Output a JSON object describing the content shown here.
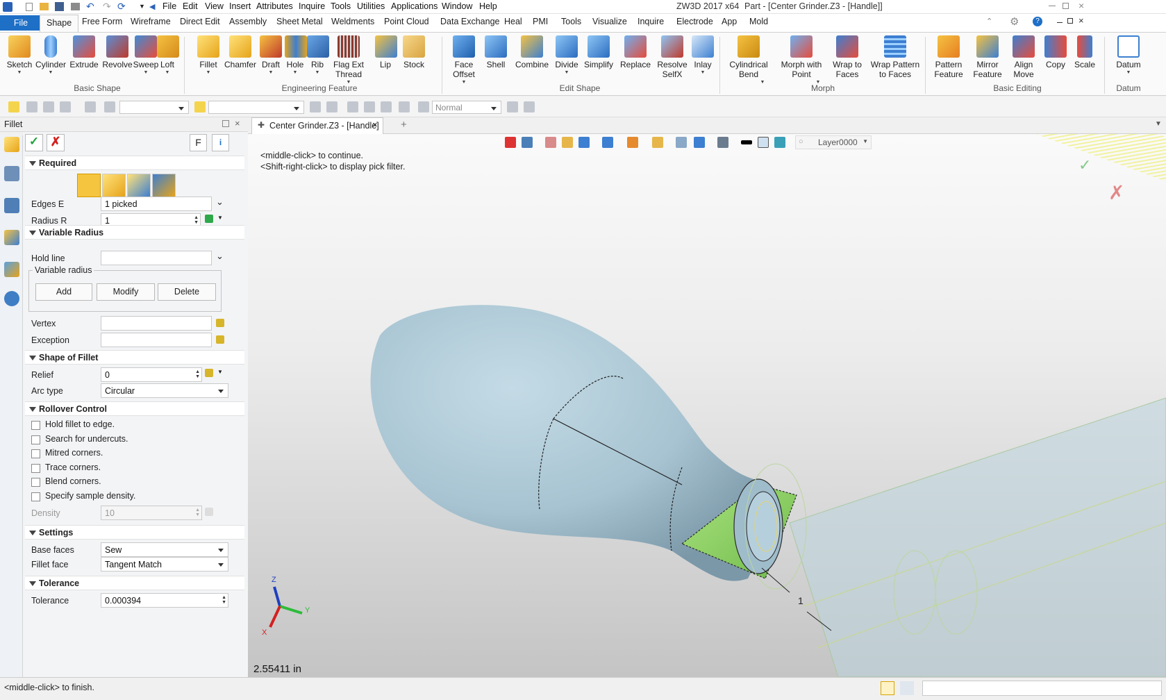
{
  "title_bar": {
    "menu": [
      "File",
      "Edit",
      "View",
      "Insert",
      "Attributes",
      "Inquire",
      "Tools",
      "Utilities",
      "Applications",
      "Window",
      "Help"
    ],
    "app_title": "ZW3D 2017  x64",
    "doc_title": "Part - [Center Grinder.Z3 - [Handle]]"
  },
  "ribbon_tabs": [
    "File",
    "Shape",
    "Free Form",
    "Wireframe",
    "Direct Edit",
    "Assembly",
    "Sheet Metal",
    "Weldments",
    "Point Cloud",
    "Data Exchange",
    "Heal",
    "PMI",
    "Tools",
    "Visualize",
    "Inquire",
    "Electrode",
    "App",
    "Mold"
  ],
  "ribbon": {
    "basic_shape": {
      "label": "Basic Shape",
      "buttons": [
        "Sketch",
        "Cylinder",
        "Extrude",
        "Revolve",
        "Sweep",
        "Loft"
      ]
    },
    "engineering_feature": {
      "label": "Engineering Feature",
      "buttons": [
        "Fillet",
        "Chamfer",
        "Draft",
        "Hole",
        "Rib",
        "Flag Ext Thread",
        "Lip",
        "Stock"
      ]
    },
    "edit_shape": {
      "label": "Edit Shape",
      "buttons": [
        "Face Offset",
        "Shell",
        "Combine",
        "Divide",
        "Simplify",
        "Replace",
        "Resolve SelfX",
        "Inlay"
      ]
    },
    "morph": {
      "label": "Morph",
      "buttons": [
        "Cylindrical Bend",
        "Morph with Point",
        "Wrap to Faces",
        "Wrap Pattern to Faces"
      ]
    },
    "basic_editing": {
      "label": "Basic Editing",
      "buttons": [
        "Pattern Feature",
        "Mirror Feature",
        "Align Move",
        "Copy",
        "Scale"
      ]
    },
    "datum": {
      "label": "Datum",
      "buttons": [
        "Datum"
      ]
    }
  },
  "toolbar": {
    "render_mode": "Normal"
  },
  "panel": {
    "title": "Fillet",
    "f_button": "F",
    "sections": {
      "required": "Required",
      "variable_radius": "Variable Radius",
      "shape_of_fillet": "Shape of Fillet",
      "rollover_control": "Rollover Control",
      "settings": "Settings",
      "tolerance": "Tolerance"
    },
    "edges_label": "Edges E",
    "edges_value": "1 picked",
    "radius_label": "Radius R",
    "radius_value": "1",
    "hold_line_label": "Hold line",
    "variable_radius_group": "Variable radius",
    "add_label": "Add",
    "modify_label": "Modify",
    "delete_label": "Delete",
    "vertex_label": "Vertex",
    "exception_label": "Exception",
    "relief_label": "Relief",
    "relief_value": "0",
    "arc_type_label": "Arc type",
    "arc_type_value": "Circular",
    "rollover_options": [
      "Hold fillet to edge.",
      "Search for undercuts.",
      "Mitred corners.",
      "Trace corners.",
      "Blend corners.",
      "Specify sample density."
    ],
    "density_label": "Density",
    "density_value": "10",
    "base_faces_label": "Base faces",
    "base_faces_value": "Sew",
    "fillet_face_label": "Fillet face",
    "fillet_face_value": "Tangent Match",
    "tolerance_label": "Tolerance",
    "tolerance_value": "0.000394"
  },
  "doc_tab": "Center Grinder.Z3 - [Handle]",
  "viewport": {
    "layer": "Layer0000",
    "hint1": "<middle-click> to continue.",
    "hint2": "<Shift-right-click> to display pick filter.",
    "edge_tag": "1",
    "measure": "2.55411 in",
    "axis_x": "X",
    "axis_y": "Y",
    "axis_z": "Z"
  },
  "status": {
    "text": "<middle-click> to finish."
  },
  "colors": {
    "accent": "#1e6fc6",
    "part": "#a9c7d6",
    "fillet": "#8fd66a"
  }
}
